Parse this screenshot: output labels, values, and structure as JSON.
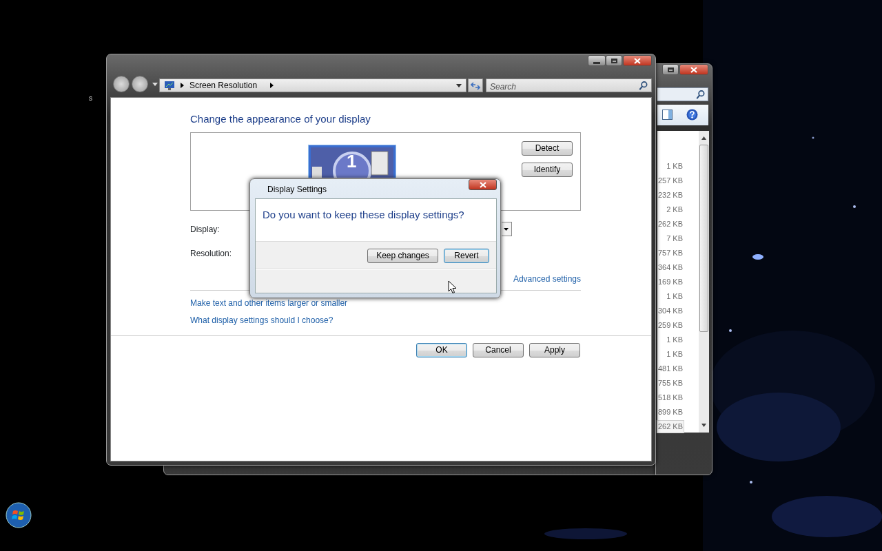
{
  "desktop": {
    "text": "s"
  },
  "back_window": {
    "file_sizes": [
      {
        "text": "1 KB",
        "selected": false
      },
      {
        "text": "257 KB",
        "selected": false
      },
      {
        "text": "232 KB",
        "selected": false
      },
      {
        "text": "2 KB",
        "selected": false
      },
      {
        "text": "262 KB",
        "selected": false
      },
      {
        "text": "7 KB",
        "selected": false
      },
      {
        "text": "757 KB",
        "selected": false
      },
      {
        "text": "364 KB",
        "selected": false
      },
      {
        "text": "169 KB",
        "selected": false
      },
      {
        "text": "1 KB",
        "selected": false
      },
      {
        "text": "304 KB",
        "selected": false
      },
      {
        "text": "259 KB",
        "selected": false
      },
      {
        "text": "1 KB",
        "selected": false
      },
      {
        "text": "1 KB",
        "selected": false
      },
      {
        "text": "481 KB",
        "selected": false
      },
      {
        "text": "755 KB",
        "selected": false
      },
      {
        "text": "518 KB",
        "selected": false
      },
      {
        "text": "899 KB",
        "selected": false
      },
      {
        "text": "262 KB",
        "selected": true
      }
    ]
  },
  "window": {
    "address": "Screen Resolution",
    "search": {
      "placeholder": "Search"
    },
    "heading": "Change the appearance of your display",
    "monitor": {
      "number": "1"
    },
    "side_buttons": [
      {
        "label": "Detect"
      },
      {
        "label": "Identify"
      }
    ],
    "fields": [
      {
        "label": "Display:",
        "kind": "dropdown"
      },
      {
        "label": "Resolution:",
        "kind": "none"
      }
    ],
    "advanced_link": "Advanced settings",
    "links": [
      "Make text and other items larger or smaller",
      "What display settings should I choose?"
    ],
    "footer_buttons": [
      {
        "label": "OK",
        "default": true
      },
      {
        "label": "Cancel",
        "default": false
      },
      {
        "label": "Apply",
        "default": false
      }
    ]
  },
  "dialog": {
    "title": "Display Settings",
    "question": "Do you want to keep these display settings?",
    "buttons": [
      {
        "label": "Keep changes",
        "default": false
      },
      {
        "label": "Revert",
        "default": true
      }
    ]
  }
}
